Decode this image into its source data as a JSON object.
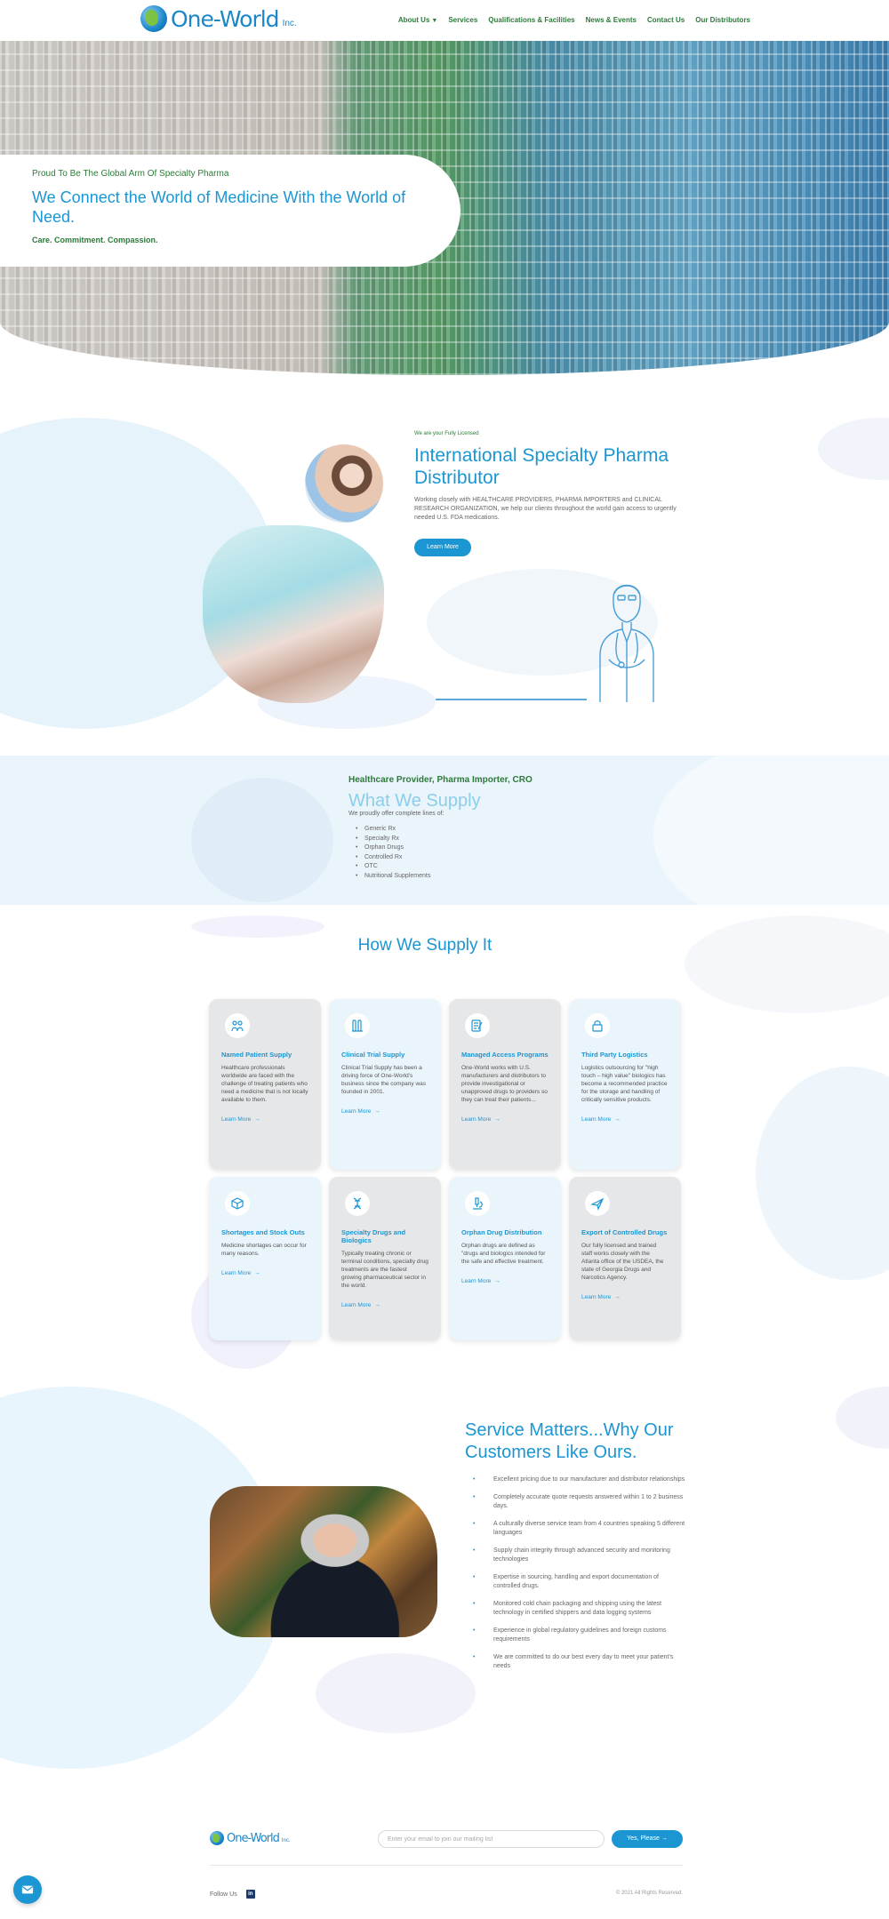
{
  "brand": {
    "name": "One-World",
    "suffix": "Inc."
  },
  "nav": {
    "items": [
      {
        "label": "About Us"
      },
      {
        "label": "Services"
      },
      {
        "label": "Qualifications & Facilities"
      },
      {
        "label": "News & Events"
      },
      {
        "label": "Contact Us"
      },
      {
        "label": "Our Distributors"
      }
    ]
  },
  "hero": {
    "kicker": "Proud To Be The Global Arm Of Specialty Pharma",
    "title": "We Connect the World of Medicine With the World of Need.",
    "tagline": "Care. Commitment. Compassion."
  },
  "licensed": {
    "kicker": "We are your Fully Licensed",
    "title": "International Specialty Pharma Distributor",
    "text": "Working closely with HEALTHCARE PROVIDERS, PHARMA IMPORTERS and CLINICAL RESEARCH ORGANIZATION, we help our clients throughout the world gain access to urgently needed U.S. FDA medications.",
    "button": "Learn More"
  },
  "supply": {
    "kicker": "Healthcare Provider, Pharma Importer, CRO",
    "title": "What We Supply",
    "subtitle": "We proudly offer complete lines of:",
    "items": [
      "Generic Rx",
      "Specialty Rx",
      "Orphan Drugs",
      "Controlled Rx",
      "OTC",
      "Nutritional Supplements"
    ]
  },
  "how": {
    "title": "How We Supply It",
    "link_label": "Learn More",
    "cards": [
      {
        "icon": "people-icon",
        "title": "Named Patient Supply",
        "text": "Healthcare professionals worldwide are faced with the challenge of treating patients who need a medicine that is not locally available to them."
      },
      {
        "icon": "test-tubes-icon",
        "title": "Clinical Trial Supply",
        "text": "Clinical Trial Supply has been a driving force of One-World's business since the company was founded in 2001."
      },
      {
        "icon": "document-pen-icon",
        "title": "Managed Access Programs",
        "text": "One-World works with U.S. manufacturers and distributors to provide investigational or unapproved drugs to providers so they can treat their patients..."
      },
      {
        "icon": "lock-icon",
        "title": "Third Party Logistics",
        "text": "Logistics outsourcing for \"high touch – high value\" biologics has become a recommended practice for the storage and handling of critically sensitive products."
      },
      {
        "icon": "pill-box-icon",
        "title": "Shortages and Stock Outs",
        "text": "Medicine shortages can occur for many reasons."
      },
      {
        "icon": "dna-icon",
        "title": "Specialty Drugs and Biologics",
        "text": "Typically treating chronic or terminal conditions, specialty drug treatments are the fastest growing pharmaceutical sector in the world."
      },
      {
        "icon": "microscope-icon",
        "title": "Orphan Drug Distribution",
        "text": "Orphan drugs are defined as \"drugs and biologics intended for the safe and effective treatment."
      },
      {
        "icon": "airplane-icon",
        "title": "Export of Controlled Drugs",
        "text": "Our fully licensed and trained staff works closely with the Atlanta office of the USDEA, the state of Georgia Drugs and Narcotics Agency."
      }
    ]
  },
  "service": {
    "title": "Service Matters...Why Our Customers Like Ours.",
    "items": [
      "Excellent pricing due to our manufacturer and distributor relationships",
      "Completely accurate quote requests answered within 1 to 2 business days.",
      "A culturally diverse service team from 4 countries speaking 5 different languages",
      "Supply chain integrity through advanced security and monitoring technologies",
      "Expertise in sourcing, handling and export documentation of controlled drugs.",
      "Monitored cold chain packaging and shipping using the latest technology in certified shippers and data logging systems",
      "Experience in global regulatory guidelines and foreign customs requirements",
      "We are committed to do our best every day to meet your patient's needs"
    ]
  },
  "footer": {
    "email_placeholder": "Enter your email to join our mailing list",
    "subscribe_button": "Yes, Please",
    "follow_label": "Follow Us",
    "social": "in",
    "copyright": "© 2021 All Rights Reserved."
  },
  "colors": {
    "primary_blue": "#1b96d3",
    "brand_green": "#2d7a3a",
    "light_blue_bg": "#eaf4fb",
    "card_grey": "#e6e7e8"
  }
}
